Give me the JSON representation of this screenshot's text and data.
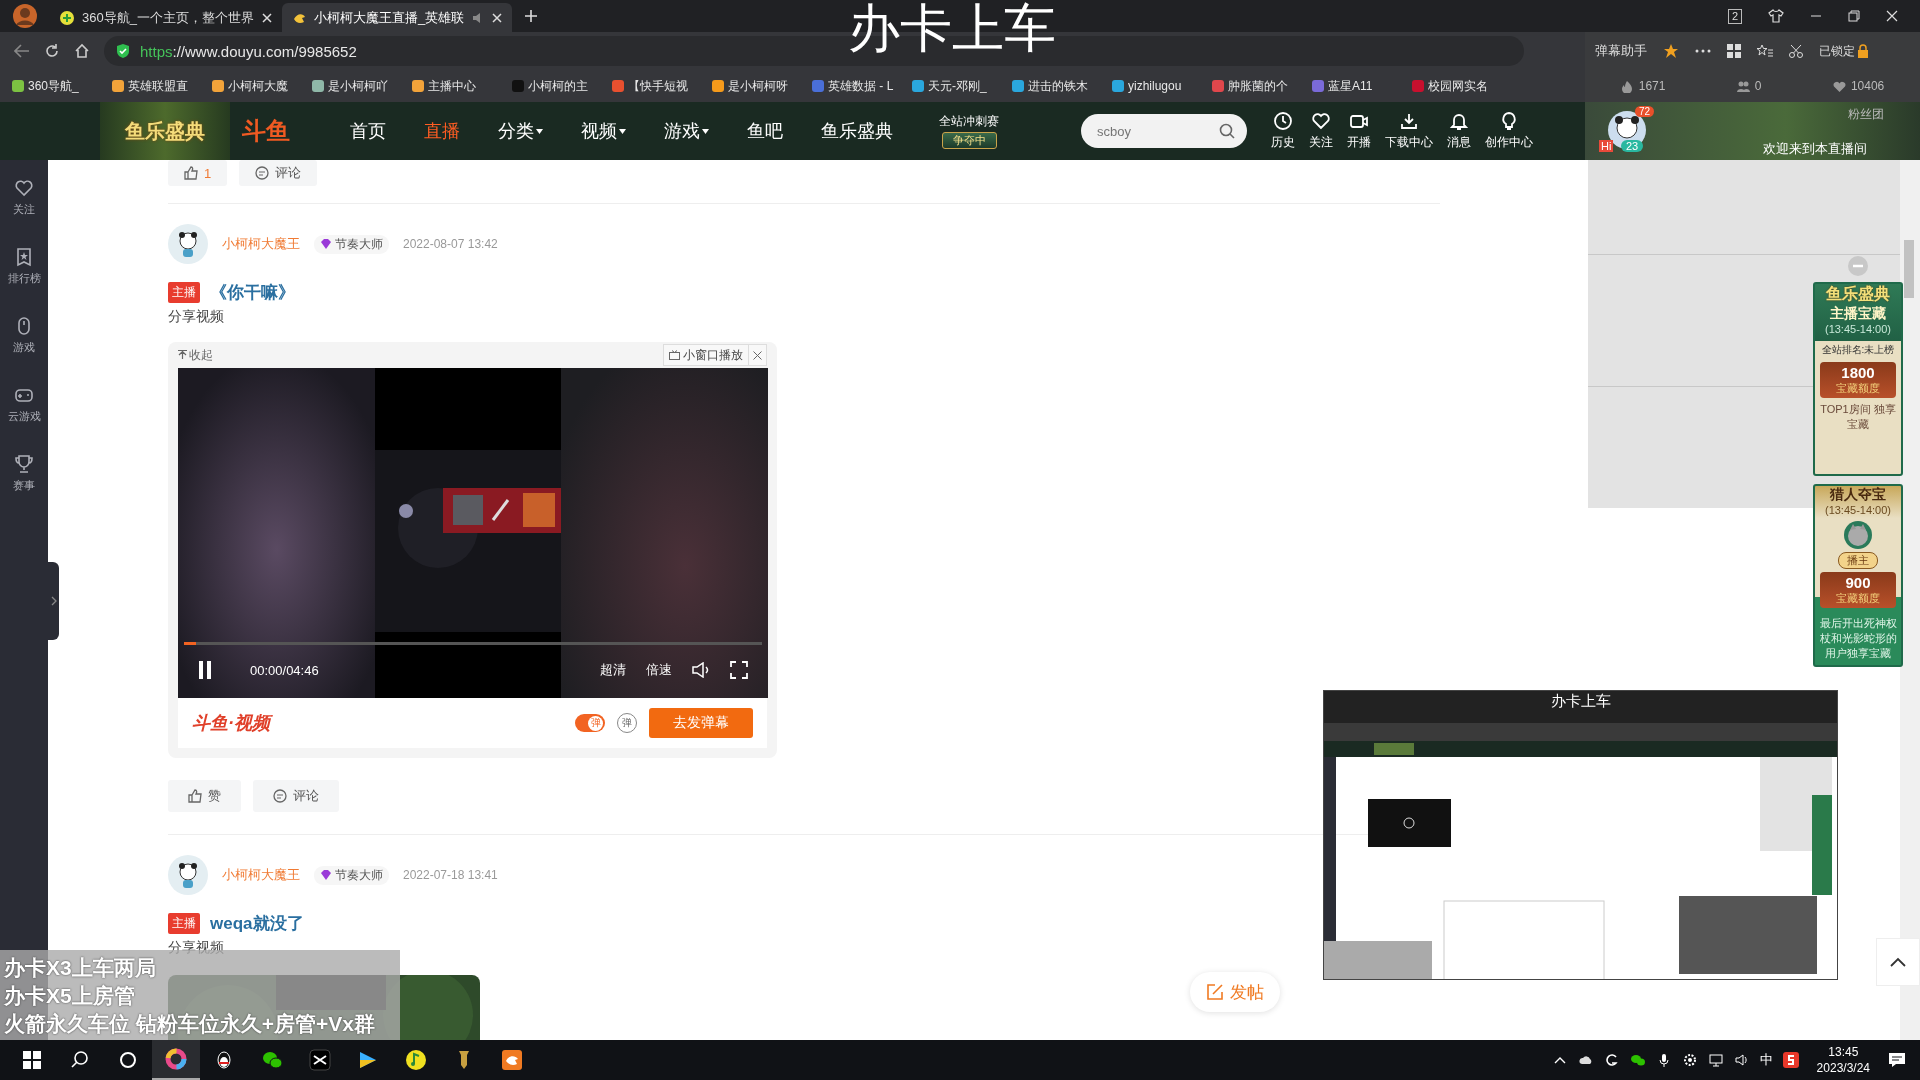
{
  "browser": {
    "tabs": [
      {
        "title": "360导航_一个主页，整个世界",
        "selected": false
      },
      {
        "title": "小柯柯大魔王直播_英雄联",
        "selected": true
      }
    ],
    "window_badge": "2",
    "url": {
      "scheme": "https",
      "rest": "://www.douyu.com/9985652"
    },
    "bookmarks": [
      {
        "label": "360导航_",
        "color": "#7cc242"
      },
      {
        "label": "英雄联盟直",
        "color": "#f2a33a"
      },
      {
        "label": "小柯柯大魔",
        "color": "#f2a33a"
      },
      {
        "label": "是小柯柯吖",
        "color": "#8fb8a8"
      },
      {
        "label": "主播中心",
        "color": "#f2a33a"
      },
      {
        "label": "小柯柯的主",
        "color": "#111111"
      },
      {
        "label": "【快手短视",
        "color": "#e8502f"
      },
      {
        "label": "是小柯柯呀",
        "color": "#f59a1b"
      },
      {
        "label": "英雄数据 - L",
        "color": "#4a6fd8"
      },
      {
        "label": "天元-邓刚_",
        "color": "#2aa7dd"
      },
      {
        "label": "进击的铁木",
        "color": "#2aa7dd"
      },
      {
        "label": "yizhilugou",
        "color": "#2aa7dd"
      },
      {
        "label": "肿胀菌的个",
        "color": "#e0474c"
      },
      {
        "label": "蓝星A11",
        "color": "#7a6ad8"
      },
      {
        "label": "校园网实名",
        "color": "#c8102e"
      }
    ]
  },
  "stream_overlay": {
    "title": "办卡上车",
    "promo_lines": [
      "办卡X3上车两局",
      "办卡X5上房管",
      "火箭永久车位 钻粉车位永久+房管+Vx群"
    ],
    "preview_title": "办卡上车"
  },
  "danmaku_assistant": {
    "title": "弹幕助手",
    "lock_label": "已锁定",
    "stats": [
      "1671",
      "0",
      "10406"
    ],
    "fans_label": "粉丝团",
    "level_badge": "72",
    "hi_badge": "Hi",
    "fan_badge": "23",
    "welcome": "欢迎来到本直播间"
  },
  "site_header": {
    "banner": "鱼乐盛典",
    "logo": "斗鱼",
    "nav": [
      {
        "label": "首页",
        "selected": false,
        "dropdown": false
      },
      {
        "label": "直播",
        "selected": true,
        "dropdown": false
      },
      {
        "label": "分类",
        "selected": false,
        "dropdown": true
      },
      {
        "label": "视频",
        "selected": false,
        "dropdown": true
      },
      {
        "label": "游戏",
        "selected": false,
        "dropdown": true
      },
      {
        "label": "鱼吧",
        "selected": false,
        "dropdown": false
      },
      {
        "label": "鱼乐盛典",
        "selected": false,
        "dropdown": false
      }
    ],
    "event": {
      "title": "全站冲刺赛",
      "status": "争夺中"
    },
    "search": {
      "placeholder": "scboy"
    },
    "tools": [
      {
        "kind": "history",
        "label": "历史"
      },
      {
        "kind": "follow",
        "label": "关注"
      },
      {
        "kind": "broadcast",
        "label": "开播"
      },
      {
        "kind": "download",
        "label": "下载中心"
      },
      {
        "kind": "message",
        "label": "消息"
      },
      {
        "kind": "create",
        "label": "创作中心"
      }
    ]
  },
  "sidebar": {
    "items": [
      {
        "kind": "follow",
        "label": "关注"
      },
      {
        "kind": "rank",
        "label": "排行榜"
      },
      {
        "kind": "game",
        "label": "游戏"
      },
      {
        "kind": "cloud_game",
        "label": "云游戏"
      },
      {
        "kind": "match",
        "label": "赛事"
      }
    ]
  },
  "feed": {
    "prev_actions": {
      "likes": "1",
      "comment": "评论"
    },
    "posts": [
      {
        "author": "小柯柯大魔王",
        "badge": "节奏大师",
        "time": "2022-08-07 13:42",
        "tag": "主播",
        "title": "《你干嘛》",
        "desc": "分享视频",
        "media": {
          "kind": "player",
          "collapse": "收起",
          "mini_window": "小窗口播放",
          "time": "00:00/04:46",
          "quality": "超清",
          "speed": "倍速",
          "level": 0.02,
          "brand": "斗鱼·视频",
          "danmaku_on": true,
          "danmaku_toggle": "弹",
          "danmaku_settings": "弹",
          "send_button": "去发弹幕"
        },
        "actions": {
          "like": "赞",
          "comment": "评论"
        }
      },
      {
        "author": "小柯柯大魔王",
        "badge": "节奏大师",
        "time": "2022-07-18 13:41",
        "tag": "主播",
        "title": "weqa就没了",
        "desc": "分享视频",
        "media": {
          "kind": "thumbnail"
        }
      }
    ],
    "post_button": "发帖"
  },
  "treasures": [
    {
      "kind": "anchor",
      "banner": "鱼乐盛典",
      "title": "主播宝藏",
      "period": "(13:45-14:00)",
      "rank": "全站排名:未上榜",
      "amount": "1800",
      "amount_label": "宝藏额度",
      "note": "TOP1房间 独享宝藏"
    },
    {
      "kind": "hunter",
      "title": "猎人夺宝",
      "period": "(13:45-14:00)",
      "role": "播主",
      "amount": "900",
      "amount_label": "宝藏额度",
      "note": "最后开出死神权杖和光影蛇形的用户独享宝藏"
    }
  ],
  "taskbar": {
    "ime": "中",
    "time": "13:45",
    "date": "2023/3/24"
  }
}
